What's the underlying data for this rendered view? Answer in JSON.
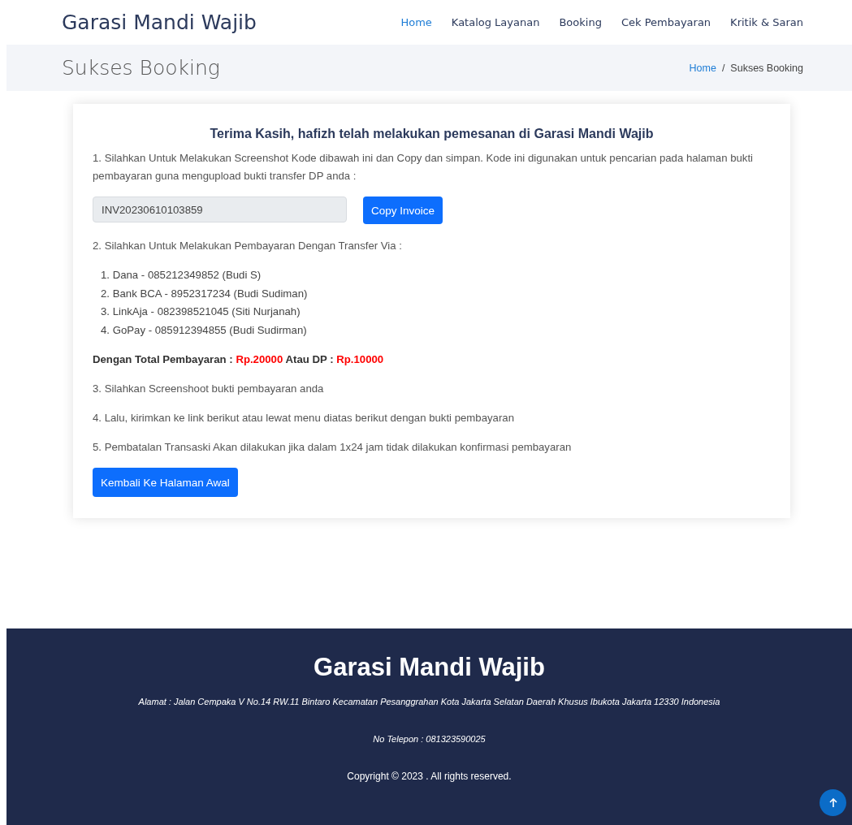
{
  "header": {
    "brand": "Garasi Mandi Wajib",
    "nav": [
      {
        "label": "Home",
        "selected": true
      },
      {
        "label": "Katalog Layanan",
        "selected": false
      },
      {
        "label": "Booking",
        "selected": false
      },
      {
        "label": "Cek Pembayaran",
        "selected": false
      },
      {
        "label": "Kritik & Saran",
        "selected": false
      }
    ]
  },
  "page_title": {
    "title": "Sukses Booking",
    "breadcrumb": [
      "Home",
      "/",
      "Sukses Booking"
    ]
  },
  "card": {
    "heading": "Terima Kasih, hafizh telah melakukan pemesanan di Garasi Mandi Wajib",
    "step_1": "1. Silahkan Untuk Melakukan Screenshot Kode dibawah ini dan Copy dan simpan. Kode ini digunakan untuk pencarian pada halaman bukti pembayaran guna mengupload bukti transfer DP anda :",
    "invoice_value": "INV20230610103859",
    "copy_button": "Copy Invoice",
    "step_2": "2. Silahkan Untuk Melakukan Pembayaran Dengan Transfer Via :",
    "payment_methods": [
      "1. Dana - 085212349852 (Budi S)",
      "2. Bank BCA - 8952317234 (Budi Sudiman)",
      "3. LinkAja - 082398521045 (Siti Nurjanah)",
      "4. GoPay - 085912394855 (Budi Sudirman)"
    ],
    "total": {
      "label": "Dengan Total Pembayaran :",
      "total_amount": "Rp.20000",
      "dp_label": "Atau DP :",
      "dp_amount": "Rp.10000"
    },
    "steps": [
      "3. Silahkan Screenshoot bukti pembayaran anda",
      "4. Lalu, kirimkan ke link berikut atau lewat menu diatas berikut dengan bukti pembayaran",
      "5. Pembatalan Transaski Akan dilakukan jika dalam 1x24 jam tidak dilakukan konfirmasi pembayaran"
    ],
    "back_button": "Kembali Ke Halaman Awal"
  },
  "footer": {
    "brand": "Garasi Mandi Wajib",
    "address": "Alamat : Jalan Cempaka V No.14 RW.11 Bintaro Kecamatan Pesanggrahan Kota Jakarta Selatan Daerah Khusus Ibukota Jakarta 12330 Indonesia",
    "phone": "No Telepon : 081323590025",
    "copyright": "Copyright © 2023 . All rights reserved."
  }
}
